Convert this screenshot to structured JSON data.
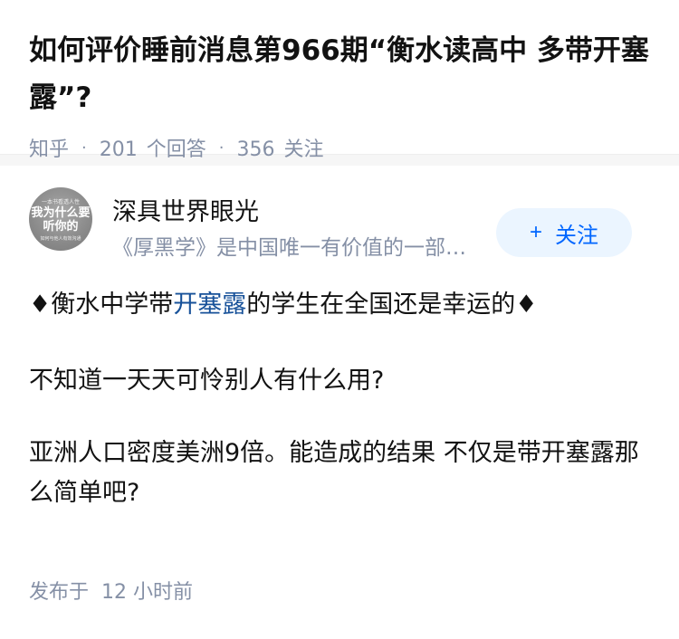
{
  "question": {
    "title": "如何评价睡前消息第966期“衡水读高中 多带开塞露”?",
    "source": "知乎",
    "separator": "·",
    "answer_count": "201",
    "answer_label": "个回答",
    "follow_count": "356",
    "follow_label": "关注"
  },
  "author": {
    "name": "深具世界眼光",
    "bio": "《厚黑学》是中国唯一有价值的一部哲学",
    "avatar_text_top": "一本书看透人性",
    "avatar_text_main": "我为什么要听你的",
    "avatar_text_bottom": "如何与他人有效沟通",
    "follow_plus": "+",
    "follow_label": "关注"
  },
  "answer": {
    "line1_prefix": "♦衡水中学带",
    "line1_link": "开塞露",
    "line1_suffix": "的学生在全国还是幸运的♦",
    "line2": "不知道一天天可怜别人有什么用?",
    "line3": "亚洲人口密度美洲9倍。能造成的结果 不仅是带开塞露那么简单吧?"
  },
  "post_time": {
    "label": "发布于",
    "value": "12 小时前"
  },
  "colors": {
    "meta_gray": "#8590a6",
    "link_blue": "#175199",
    "button_blue": "#0066ff",
    "button_bg": "#ebf5ff"
  }
}
